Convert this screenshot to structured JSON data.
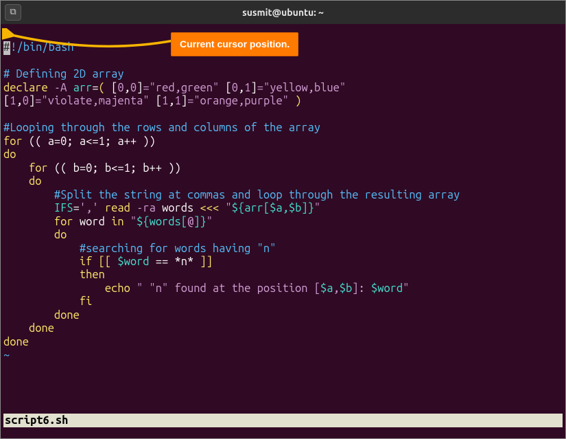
{
  "titlebar": {
    "title": "susmit@ubuntu: ~",
    "icon_glyph": "⧉"
  },
  "callout": {
    "text": "Current cursor position."
  },
  "code": {
    "l1_a": "#",
    "l1_b": "!/bin/bash",
    "l3": "# Defining 2D array",
    "l4_declare": "declare",
    "l4_flag": " -A ",
    "l4_arr": "arr",
    "l4_eq": "=",
    "l4_po": "( ",
    "l4_bo1": "[",
    "l4_n0a": "0",
    "l4_c1": ",",
    "l4_n0b": "0",
    "l4_bc1": "]",
    "l4_s1": "=\"red,green\"",
    "l4_sp1": " ",
    "l4_bo2": "[",
    "l4_n0c": "0",
    "l4_c2": ",",
    "l4_n1a": "1",
    "l4_bc2": "]",
    "l4_s2": "=\"yellow,blue\"",
    "l5_bo1": "[",
    "l5_n1a": "1",
    "l5_c1": ",",
    "l5_n0a": "0",
    "l5_bc1": "]",
    "l5_s1": "=\"violate,majenta\"",
    "l5_sp1": " ",
    "l5_bo2": "[",
    "l5_n1b": "1",
    "l5_c2": ",",
    "l5_n1c": "1",
    "l5_bc2": "]",
    "l5_s2": "=\"orange,purple\"",
    "l5_pc": " )",
    "l7": "#Looping through the rows and columns of the array",
    "l8_for": "for",
    "l8_rest": " (( a=0; a<=1; a++ ))",
    "l9": "do",
    "l10_ind": "    ",
    "l10_for": "for",
    "l10_rest": " (( b=0; b<=1; b++ ))",
    "l11": "    do",
    "l12_ind": "        ",
    "l12": "#Split the string at commas and loop through the resulting array",
    "l13_ind": "        ",
    "l13_ifs": "IFS",
    "l13_eq": "=",
    "l13_q": "','",
    "l13_sp": " ",
    "l13_read": "read",
    "l13_flag": " -ra ",
    "l13_words": "words",
    "l13_here": " <<< ",
    "l13_q1": "\"",
    "l13_exp": "${arr[$a,$b]}",
    "l13_q2": "\"",
    "l14_ind": "        ",
    "l14_for": "for",
    "l14_word": " word ",
    "l14_in": "in",
    "l14_sp": " ",
    "l14_q1": "\"",
    "l14_exp": "${words[",
    "l14_at": "@",
    "l14_expc": "]}",
    "l14_q2": "\"",
    "l15": "        do",
    "l16_ind": "            ",
    "l16": "#searching for words having \"n\"",
    "l17_ind": "            ",
    "l17_if": "if",
    "l17_bo": " [[ ",
    "l17_w": "$word",
    "l17_eq": " == ",
    "l17_pat": "*n*",
    "l17_bc": " ]]",
    "l18_ind": "            ",
    "l18_then": "then",
    "l19_ind": "                ",
    "l19_echo": "echo",
    "l19_q1": " \" \"n\" found at the position [",
    "l19_a": "$a",
    "l19_c": ",",
    "l19_b": "$b",
    "l19_q2": "]: ",
    "l19_w": "$word",
    "l19_q3": "\"",
    "l20_ind": "            ",
    "l20_fi": "fi",
    "l21_ind": "        ",
    "l21_done": "done",
    "l22_ind": "    ",
    "l22_done": "done",
    "l23_done": "done",
    "tilde": "~"
  },
  "statusbar": {
    "filename": "script6.sh"
  }
}
